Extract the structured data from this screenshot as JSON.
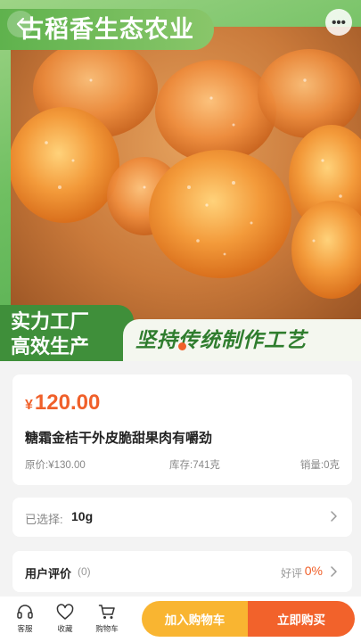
{
  "hero": {
    "brand": "古稻香生态农业",
    "slogan_left_line1": "实力工厂",
    "slogan_left_line2": "高效生产",
    "slogan_right": "坚持传统制作工艺",
    "more_label": "•••"
  },
  "product": {
    "currency": "¥",
    "price": "120.00",
    "title": "糖霜金桔干外皮脆甜果肉有嚼劲",
    "original_price": "原价:¥130.00",
    "stock": "库存:741克",
    "sales": "销量:0克"
  },
  "spec": {
    "label": "已选择:",
    "value": "10g"
  },
  "review": {
    "title": "用户评价",
    "count": "(0)",
    "good_label": "好评",
    "good_rate": "0%"
  },
  "bottom_bar": {
    "service": "客服",
    "favorite": "收藏",
    "cart": "购物车",
    "add_to_cart": "加入购物车",
    "buy_now": "立即购买"
  },
  "colors": {
    "accent": "#f0602a",
    "cart_button": "#f9b531",
    "buy_button": "#f2622b",
    "brand_green": "#5fb24d"
  },
  "icons": [
    "back-icon",
    "more-icon",
    "chevron-right-icon",
    "headset-icon",
    "heart-icon",
    "cart-icon"
  ]
}
